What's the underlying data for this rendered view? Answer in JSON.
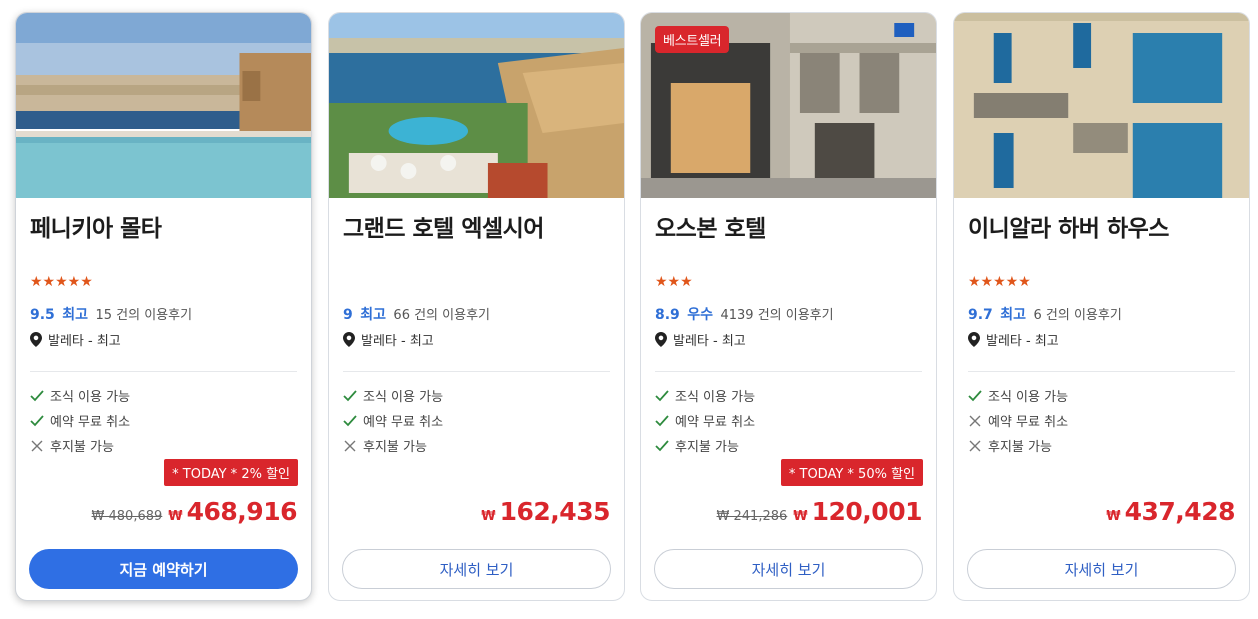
{
  "colors": {
    "accent": "#2f6fe4",
    "price_red": "#d9262c",
    "stars": "#e0561b",
    "rating_blue": "#2f6fd6",
    "check_green": "#2e8b3e"
  },
  "hotels": [
    {
      "name": "페니키아 몰타",
      "stars": "★★★★★",
      "stars_count": 5,
      "score": "9.5",
      "score_label": "최고",
      "reviews": "15 건의 이용후기",
      "location": "발레타 - 최고",
      "features": [
        {
          "label": "조식 이용 가능",
          "available": true
        },
        {
          "label": "예약 무료 취소",
          "available": true
        },
        {
          "label": "후지불 가능",
          "available": false
        }
      ],
      "promo": "* TODAY * 2% 할인",
      "old_price": "₩ 480,689",
      "currency": "₩",
      "price": "468,916",
      "button": "지금 예약하기",
      "badge": ""
    },
    {
      "name": "그랜드 호텔 엑셀시어",
      "stars": "",
      "stars_count": 0,
      "score": "9",
      "score_label": "최고",
      "reviews": "66 건의 이용후기",
      "location": "발레타 - 최고",
      "features": [
        {
          "label": "조식 이용 가능",
          "available": true
        },
        {
          "label": "예약 무료 취소",
          "available": true
        },
        {
          "label": "후지불 가능",
          "available": false
        }
      ],
      "promo": "",
      "old_price": "",
      "currency": "₩",
      "price": "162,435",
      "button": "자세히 보기",
      "badge": ""
    },
    {
      "name": "오스본 호텔",
      "stars": "★★★",
      "stars_count": 3,
      "score": "8.9",
      "score_label": "우수",
      "reviews": "4139 건의 이용후기",
      "location": "발레타 - 최고",
      "features": [
        {
          "label": "조식 이용 가능",
          "available": true
        },
        {
          "label": "예약 무료 취소",
          "available": true
        },
        {
          "label": "후지불 가능",
          "available": true
        }
      ],
      "promo": "* TODAY * 50% 할인",
      "old_price": "₩ 241,286",
      "currency": "₩",
      "price": "120,001",
      "button": "자세히 보기",
      "badge": "베스트셀러"
    },
    {
      "name": "이니알라 하버 하우스",
      "stars": "★★★★★",
      "stars_count": 5,
      "score": "9.7",
      "score_label": "최고",
      "reviews": "6 건의 이용후기",
      "location": "발레타 - 최고",
      "features": [
        {
          "label": "조식 이용 가능",
          "available": true
        },
        {
          "label": "예약 무료 취소",
          "available": false
        },
        {
          "label": "후지불 가능",
          "available": false
        }
      ],
      "promo": "",
      "old_price": "",
      "currency": "₩",
      "price": "437,428",
      "button": "자세히 보기",
      "badge": ""
    }
  ]
}
